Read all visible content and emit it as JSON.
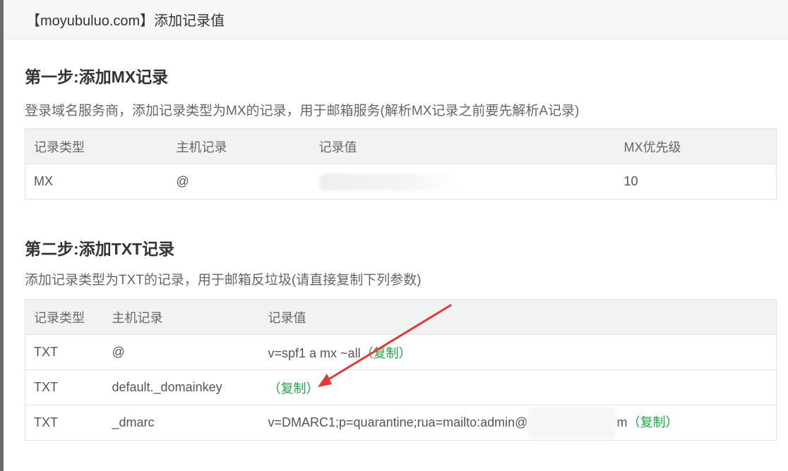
{
  "dialog": {
    "title": "【moyubuluo.com】添加记录值"
  },
  "step1": {
    "title": "第一步:添加MX记录",
    "desc": "登录域名服务商，添加记录类型为MX的记录，用于邮箱服务(解析MX记录之前要先解析A记录)",
    "headers": [
      "记录类型",
      "主机记录",
      "记录值",
      "MX优先级"
    ],
    "row": {
      "type": "MX",
      "host": "@",
      "value": "",
      "priority": "10"
    }
  },
  "step2": {
    "title": "第二步:添加TXT记录",
    "desc": "添加记录类型为TXT的记录，用于邮箱反垃圾(请直接复制下列参数)",
    "headers": [
      "记录类型",
      "主机记录",
      "记录值"
    ],
    "rows": [
      {
        "type": "TXT",
        "host": "@",
        "value": "v=spf1 a mx ~all",
        "copy": "（复制）"
      },
      {
        "type": "TXT",
        "host": "default._domainkey",
        "value": "",
        "copy": "（复制）"
      },
      {
        "type": "TXT",
        "host": "_dmarc",
        "value_prefix": "v=DMARC1;p=quarantine;rua=mailto:admin@",
        "value_suffix": "m",
        "copy": "（复制）"
      }
    ]
  },
  "annotation": {
    "arrow_color": "#e53935"
  }
}
